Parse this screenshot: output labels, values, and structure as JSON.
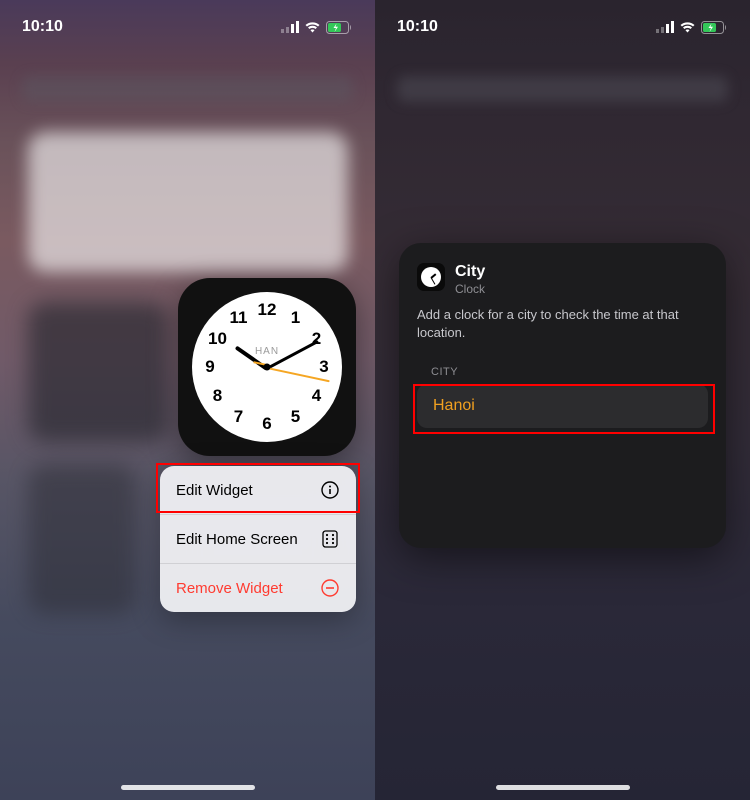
{
  "status": {
    "time": "10:10"
  },
  "clock": {
    "label": "HAN",
    "numbers": [
      "12",
      "1",
      "2",
      "3",
      "4",
      "5",
      "6",
      "7",
      "8",
      "9",
      "10",
      "11"
    ]
  },
  "menu": {
    "edit_widget": "Edit Widget",
    "edit_home_screen": "Edit Home Screen",
    "remove_widget": "Remove Widget"
  },
  "sheet": {
    "title": "City",
    "subtitle": "Clock",
    "description": "Add a clock for a city to check the time at that location.",
    "section_label": "CITY",
    "city_value": "Hanoi"
  }
}
